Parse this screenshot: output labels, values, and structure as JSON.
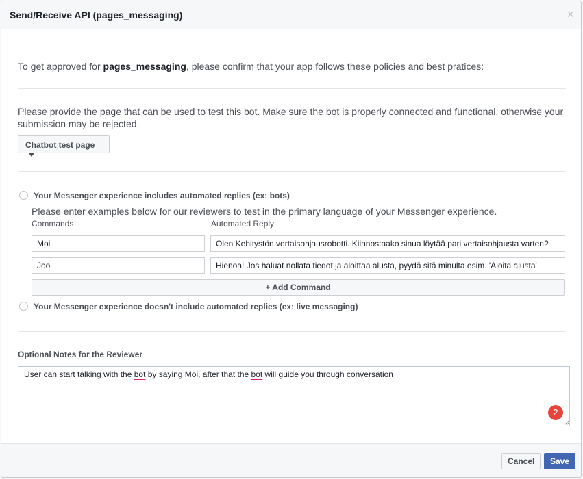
{
  "dialog": {
    "title": "Send/Receive API (pages_messaging)",
    "close_symbol": "×"
  },
  "intro": {
    "prefix": "To get approved for ",
    "permission": "pages_messaging",
    "suffix": ", please confirm that your app follows these policies and best pratices:"
  },
  "test_page": {
    "description": "Please provide the page that can be used to test this bot. Make sure the bot is properly connected and functional, otherwise your submission may be rejected.",
    "dropdown_label": "Chatbot test page"
  },
  "automated": {
    "option_label": "Your Messenger experience includes automated replies (ex: bots)",
    "hint": "Please enter examples below for our reviewers to test in the primary language of your Messenger experience.",
    "col_commands": "Commands",
    "col_reply": "Automated Reply",
    "rows": [
      {
        "command": "Moi",
        "reply": "Olen Kehitystön vertaisohjausrobotti. Kiinnostaako sinua löytää pari vertaisohjausta varten?"
      },
      {
        "command": "Joo",
        "reply": "Hienoa! Jos haluat nollata tiedot ja aloittaa alusta, pyydä sitä minulta esim. 'Aloita alusta'."
      }
    ],
    "add_command": "+ Add Command"
  },
  "live": {
    "option_label": "Your Messenger experience doesn't include automated replies (ex: live messaging)"
  },
  "notes": {
    "label": "Optional Notes for the Reviewer",
    "text_parts": [
      "User can start talking with the ",
      "bot",
      " by saying Moi, after that the ",
      "bot",
      " will guide you through conversation"
    ],
    "badge_count": "2"
  },
  "footer": {
    "cancel": "Cancel",
    "save": "Save"
  },
  "colors": {
    "primary": "#4267b2",
    "badge": "#e9443c",
    "spellcheck_underline": "#e0245e"
  }
}
